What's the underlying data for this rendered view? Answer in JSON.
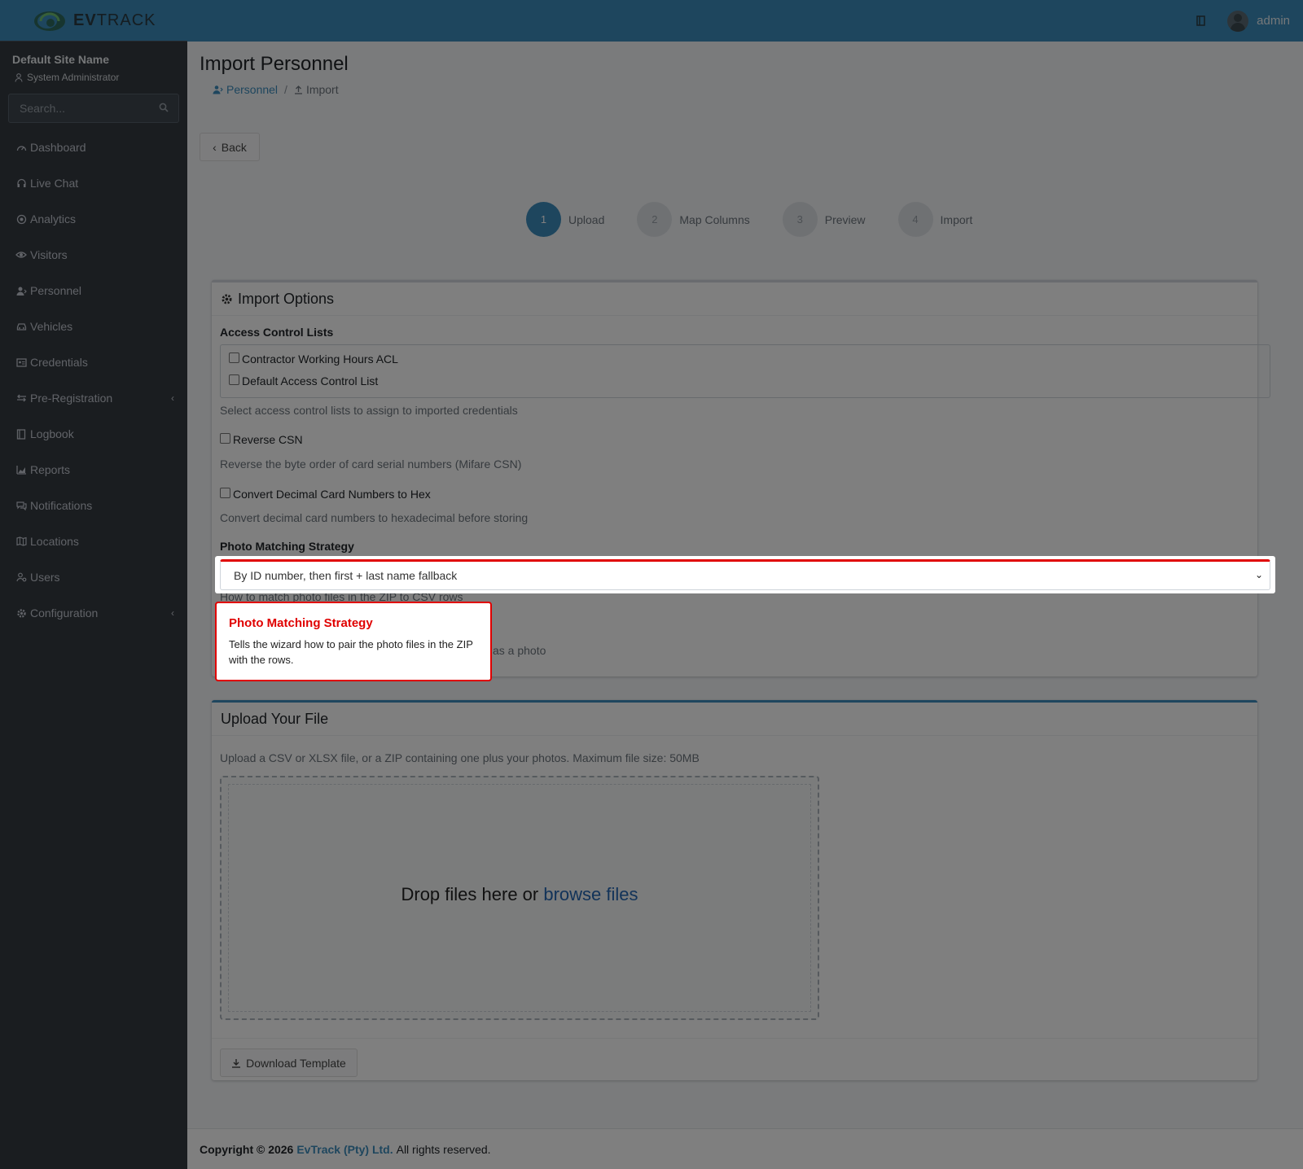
{
  "brand": {
    "logo_text_bold": "EV",
    "logo_text_rest": "TRACK"
  },
  "navbar": {
    "user_name": "admin"
  },
  "sidebar": {
    "site_name": "Default Site Name",
    "role": "System Administrator",
    "search_placeholder": "Search...",
    "items": [
      {
        "label": "Dashboard",
        "icon": "dashboard-icon"
      },
      {
        "label": "Live Chat",
        "icon": "headset-icon"
      },
      {
        "label": "Analytics",
        "icon": "target-icon"
      },
      {
        "label": "Visitors",
        "icon": "eye-icon"
      },
      {
        "label": "Personnel",
        "icon": "user-tie-icon"
      },
      {
        "label": "Vehicles",
        "icon": "car-icon"
      },
      {
        "label": "Credentials",
        "icon": "id-card-icon"
      },
      {
        "label": "Pre-Registration",
        "icon": "exchange-icon"
      },
      {
        "label": "Logbook",
        "icon": "book-icon"
      },
      {
        "label": "Reports",
        "icon": "chart-area-icon"
      },
      {
        "label": "Notifications",
        "icon": "comments-icon"
      },
      {
        "label": "Locations",
        "icon": "map-icon"
      },
      {
        "label": "Users",
        "icon": "users-cog-icon"
      },
      {
        "label": "Configuration",
        "icon": "cog-icon"
      }
    ]
  },
  "page": {
    "title": "Import Personnel",
    "breadcrumb": {
      "parent": "Personnel",
      "separator": "/",
      "current": "Import"
    },
    "back_label": "Back"
  },
  "stepper": [
    {
      "number": "1",
      "label": "Upload",
      "active": true
    },
    {
      "number": "2",
      "label": "Map Columns",
      "active": false
    },
    {
      "number": "3",
      "label": "Preview",
      "active": false
    },
    {
      "number": "4",
      "label": "Import",
      "active": false
    }
  ],
  "options": {
    "header": "Import Options",
    "acl_label": "Access Control Lists",
    "acl_items": [
      "Contractor Working Hours ACL",
      "Default Access Control List"
    ],
    "acl_help": "Select access control lists to assign to imported credentials",
    "reverse_csn_label": "Reverse CSN",
    "reverse_csn_help": "Reverse the byte order of card serial numbers (Mifare CSN)",
    "convert_label": "Convert Decimal Card Numbers to Hex",
    "convert_help": "Convert decimal card numbers to hexadecimal before storing",
    "photo_label": "Photo Matching Strategy",
    "photo_value": "By ID number, then first + last name fallback",
    "photo_help_partial": "How to match photo files in the ZIP to CSV rows",
    "behind_partial": "as a photo"
  },
  "upload": {
    "header": "Upload Your File",
    "description": "Upload a CSV or XLSX file, or a ZIP containing one plus your photos. Maximum file size: 50MB",
    "drop_text": "Drop files here or ",
    "browse_link": "browse files",
    "template_button": "Download Template"
  },
  "footer": {
    "prefix": "Copyright © 2026",
    "company": "EvTrack (Pty) Ltd.",
    "suffix": "All rights reserved."
  },
  "tooltip": {
    "title": "Photo Matching Strategy",
    "text": "Tells the wizard how to pair the photo files in the ZIP with the rows."
  },
  "colors": {
    "primary": "#3c8dbc",
    "sidebar": "#343a40",
    "tour_accent": "#e00000"
  }
}
